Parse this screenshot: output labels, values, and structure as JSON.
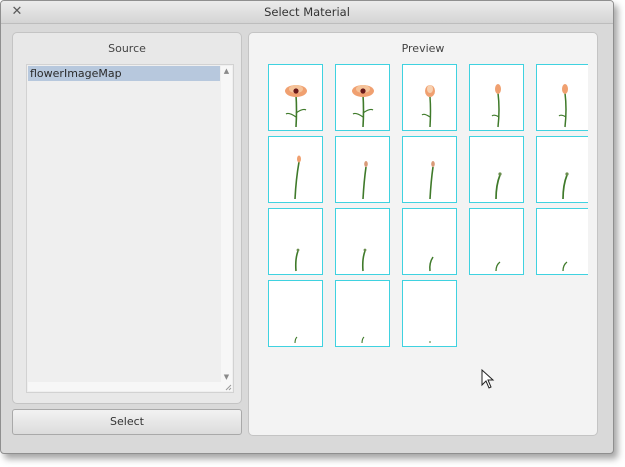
{
  "window": {
    "title": "Select Material",
    "close_glyph": "✕"
  },
  "source": {
    "label": "Source",
    "items": [
      "flowerImageMap"
    ],
    "selected_index": 0
  },
  "select_button": {
    "label": "Select"
  },
  "preview": {
    "label": "Preview",
    "frames": [
      {
        "stage": "bloom-open"
      },
      {
        "stage": "bloom-open"
      },
      {
        "stage": "bloom-half"
      },
      {
        "stage": "bud-big"
      },
      {
        "stage": "bud-big"
      },
      {
        "stage": "bud-medium"
      },
      {
        "stage": "bud-small"
      },
      {
        "stage": "bud-small"
      },
      {
        "stage": "stem-tall"
      },
      {
        "stage": "stem-tall"
      },
      {
        "stage": "stem-medium"
      },
      {
        "stage": "stem-medium"
      },
      {
        "stage": "stem-short"
      },
      {
        "stage": "sprout"
      },
      {
        "stage": "sprout"
      },
      {
        "stage": "sprout-tiny"
      },
      {
        "stage": "sprout-tiny"
      },
      {
        "stage": "seed"
      }
    ]
  },
  "icons": {
    "close": "close-icon",
    "cursor": "mouse-pointer-icon"
  },
  "colors": {
    "frame_border": "#3fd2e0",
    "selection": "#b7c8dd",
    "stem": "#3f7a2a",
    "petal": "#f0a070"
  }
}
